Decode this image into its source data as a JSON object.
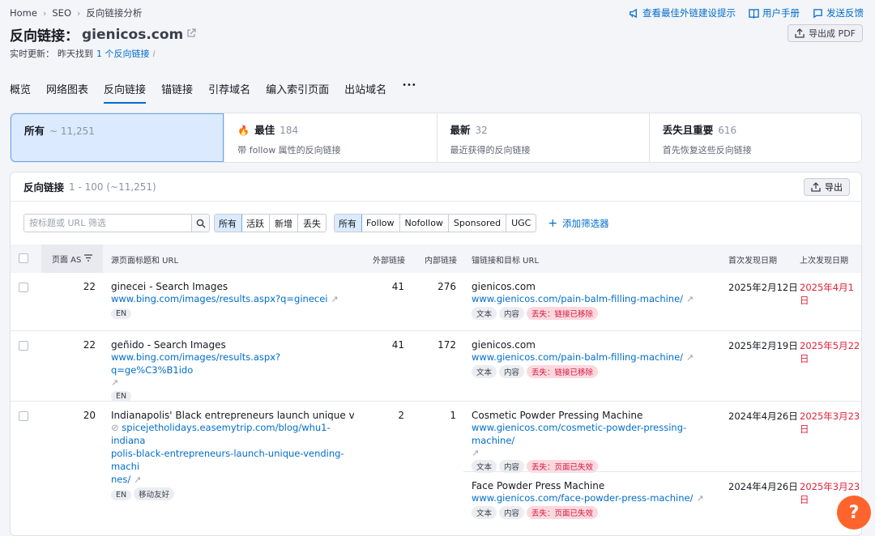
{
  "breadcrumb": {
    "home": "Home",
    "seo": "SEO",
    "current": "反向链接分析"
  },
  "toplinks": {
    "tips": "查看最佳外链建设提示",
    "manual": "用户手册",
    "feedback": "发送反馈"
  },
  "page": {
    "title": "反向链接：",
    "domain": "gienicos.com",
    "export_pdf": "导出成 PDF",
    "update_label": "实时更新：",
    "update_text": "昨天找到",
    "update_link": "1 个反向链接",
    "info": "i"
  },
  "tabs": [
    "概览",
    "网络图表",
    "反向链接",
    "锚链接",
    "引荐域名",
    "编入索引页面",
    "出站域名",
    "•••"
  ],
  "cards": [
    {
      "title": "所有",
      "count": "~ 11,251",
      "desc": ""
    },
    {
      "title": "最佳",
      "count": "184",
      "desc": "带 follow 属性的反向链接"
    },
    {
      "title": "最新",
      "count": "32",
      "desc": "最近获得的反向链接"
    },
    {
      "title": "丢失且重要",
      "count": "616",
      "desc": "首先恢复这些反向链接"
    }
  ],
  "panel": {
    "title": "反向链接",
    "range": "1 - 100 (~11,251)",
    "export": "导出"
  },
  "filters": {
    "placeholder": "按标题或 URL 筛选",
    "status": [
      "所有",
      "活跃",
      "新增",
      "丢失"
    ],
    "types": [
      "所有",
      "Follow",
      "Nofollow",
      "Sponsored",
      "UGC"
    ],
    "add": "添加筛选器"
  },
  "columns": {
    "as": "页面 AS",
    "source": "源页面标题和 URL",
    "ext": "外部链接",
    "int": "内部链接",
    "anchor": "锚链接和目标 URL",
    "first": "首次发现日期",
    "last": "上次发现日期"
  },
  "rows": [
    {
      "as": "22",
      "title": "ginecei - Search Images",
      "url": "www.bing.com/images/results.aspx?q=ginecei",
      "tags": [
        "EN"
      ],
      "ext": "41",
      "int": "276",
      "anchor": "gienicos.com",
      "target": "www.gienicos.com/pain-balm-filling-machine/",
      "atags": [
        "文本",
        "内容"
      ],
      "lost": "丢失：链接已移除",
      "first": "2025年2月12日",
      "last": "2025年4月1日"
    },
    {
      "as": "22",
      "title": "geñido - Search Images",
      "url": "www.bing.com/images/results.aspx?q=ge%C3%B1ido",
      "tags": [
        "EN"
      ],
      "ext": "41",
      "int": "172",
      "anchor": "gienicos.com",
      "target": "www.gienicos.com/pain-balm-filling-machine/",
      "atags": [
        "文本",
        "内容"
      ],
      "lost": "丢失：链接已移除",
      "first": "2025年2月19日",
      "last": "2025年5月22日"
    },
    {
      "as": "20",
      "title": "Indianapolis' Black entrepreneurs launch unique vendi…",
      "url1": "spicejetholidays.easemytrip.com/blog/whu1-indiana",
      "url2": "polis-black-entrepreneurs-launch-unique-vending-machi",
      "url3": "nes/",
      "tags": [
        "EN",
        "移动友好"
      ],
      "ext": "2",
      "int": "1",
      "anchor": "Cosmetic Powder Pressing Machine",
      "target": "www.gienicos.com/cosmetic-powder-pressing-machine/",
      "atags": [
        "文本",
        "内容"
      ],
      "lost": "丢失：页面已失效",
      "first": "2024年4月26日",
      "last": "2025年3月23日",
      "anchor2": "Face Powder Press Machine",
      "target2": "www.gienicos.com/face-powder-press-machine/",
      "lost2": "丢失：页面已失效",
      "first2": "2024年4月26日",
      "last2": "2025年3月23日"
    }
  ],
  "help": "?"
}
